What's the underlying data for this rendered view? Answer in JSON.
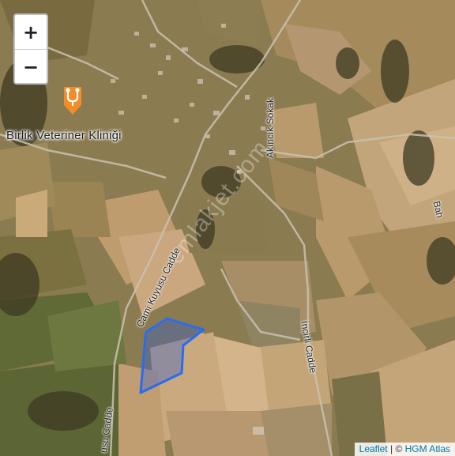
{
  "map": {
    "zoom_in_label": "+",
    "zoom_out_label": "−",
    "poi": {
      "name": "Birlik Veteriner Kliniği",
      "icon": "veterinary-icon",
      "color": "#f28c28"
    },
    "roads": [
      {
        "id": "akincik",
        "label": "Akıncık Sokak"
      },
      {
        "id": "cami-kuyusu",
        "label": "Cami Kuyusu Cadde"
      },
      {
        "id": "incirli",
        "label": "İncirli Cadde"
      },
      {
        "id": "kuyusu-lower",
        "label": "usu Cadde"
      },
      {
        "id": "bahce-right",
        "label": "Bah"
      }
    ],
    "parcel_color": "#2a6cf0",
    "watermark": "emlakjet.com",
    "attribution": {
      "leaflet": "Leaflet",
      "separator": " | © ",
      "provider": "HGM Atlas"
    }
  }
}
